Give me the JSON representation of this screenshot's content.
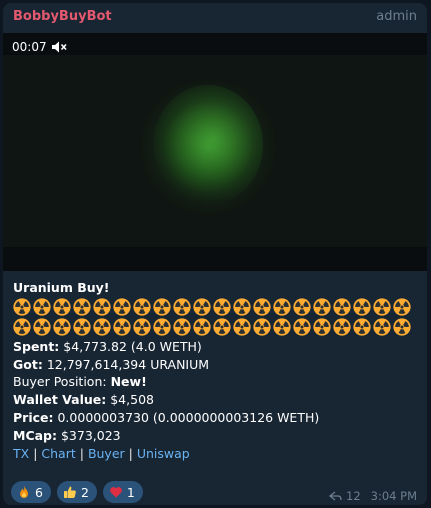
{
  "message": {
    "sender": "BobbyBuyBot",
    "role": "admin",
    "video": {
      "time": "00:07"
    },
    "title": "Uranium Buy!",
    "emoji_count": 40,
    "spent_label": "Spent:",
    "spent_value": "$4,773.82 (4.0 WETH)",
    "got_label": "Got:",
    "got_value": "12,797,614,394 URANIUM",
    "position_label": "Buyer Position:",
    "position_value": "New!",
    "wallet_label": "Wallet Value:",
    "wallet_value": "$4,508",
    "price_label": "Price:",
    "price_value": "0.0000003730 (0.0000000003126 WETH)",
    "mcap_label": "MCap:",
    "mcap_value": "$373,023",
    "links": {
      "tx": "TX",
      "chart": "Chart",
      "buyer": "Buyer",
      "uniswap": "Uniswap",
      "separator": "|"
    },
    "reactions": [
      {
        "icon": "fire-icon",
        "count": "6"
      },
      {
        "icon": "thumbs-up-icon",
        "count": "2"
      },
      {
        "icon": "heart-icon",
        "count": "1"
      }
    ],
    "views": "12",
    "timestamp": "3:04 PM"
  },
  "colors": {
    "background": "#0e1621",
    "bubble": "#182533",
    "sender": "#e5596f",
    "link": "#6ab3f3",
    "reaction": "#2b5278"
  }
}
